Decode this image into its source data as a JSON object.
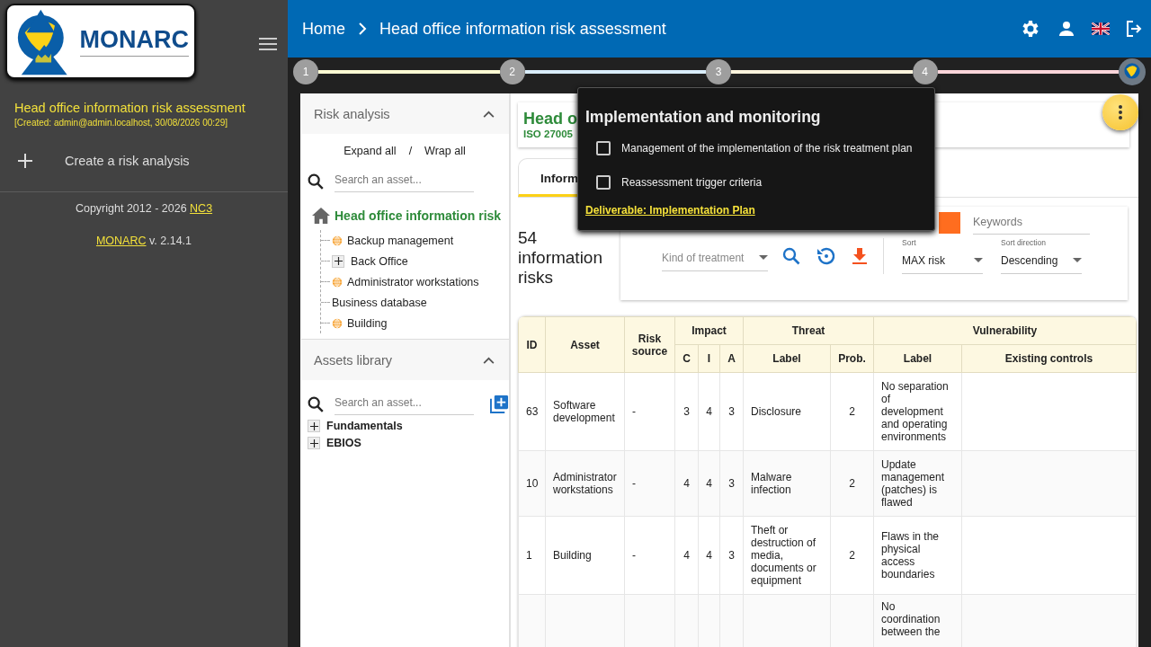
{
  "sidebar": {
    "logo_text": "MONARC",
    "project_title": "Head office information risk assessment",
    "project_created": "[Created: admin@admin.localhost, 30/08/2026 00:29]",
    "create_label": "Create a risk analysis",
    "copyright": "Copyright 2012 - 2026",
    "copyright_link": "NC3",
    "version_link": "MONARC",
    "version": "v. 2.14.1"
  },
  "topbar": {
    "breadcrumb": [
      "Home",
      "Head office information risk assessment"
    ]
  },
  "steps": [
    {
      "kind": "number",
      "label": "1",
      "color": "#fdfbd3"
    },
    {
      "kind": "number",
      "label": "2",
      "color": "#d9edfb"
    },
    {
      "kind": "number",
      "label": "3",
      "color": "#fbf3dc"
    },
    {
      "kind": "number",
      "label": "4",
      "color": "#fbd5da"
    },
    {
      "kind": "logo"
    }
  ],
  "risk_analysis_panel": {
    "title": "Risk analysis",
    "expand_label": "Expand all",
    "separator": "/",
    "wrap_label": "Wrap all",
    "search_placeholder": "Search an asset...",
    "root": "Head office information risk",
    "children": [
      {
        "kind": "globe",
        "label": "Backup management"
      },
      {
        "kind": "expandable",
        "label": "Back Office"
      },
      {
        "kind": "globe",
        "label": "Administrator workstations"
      },
      {
        "kind": "plain",
        "label": "Business database"
      },
      {
        "kind": "globe",
        "label": "Building"
      }
    ]
  },
  "assets_library": {
    "title": "Assets library",
    "search_placeholder": "Search an asset...",
    "items": [
      {
        "label": "Fundamentals"
      },
      {
        "label": "EBIOS"
      }
    ]
  },
  "header_card": {
    "title": "Head o",
    "subtitle": "ISO 27005"
  },
  "tabs": [
    {
      "label": "Inform",
      "selected": true
    }
  ],
  "risk_count": "54 information risks",
  "filters": {
    "keywords_placeholder": "Keywords",
    "treatment_placeholder": "Kind of treatment",
    "sort_label": "Sort",
    "sort_value": "MAX risk",
    "direction_label": "Sort direction",
    "direction_value": "Descending"
  },
  "table": {
    "groups": [
      {
        "label": "ID"
      },
      {
        "label": "Asset"
      },
      {
        "label": "Risk source"
      },
      {
        "label": "Impact",
        "children": [
          "C",
          "I",
          "A"
        ]
      },
      {
        "label": "Threat",
        "children": [
          "Label",
          "Prob."
        ]
      },
      {
        "label": "Vulnerability",
        "children": [
          "Label",
          "Existing controls"
        ]
      }
    ],
    "rows": [
      {
        "id": "63",
        "asset": "Software development",
        "source": "-",
        "c": "3",
        "i": "4",
        "a": "3",
        "threat": "Disclosure",
        "prob": "2",
        "vulnerability": "No separation of development and operating environments"
      },
      {
        "id": "10",
        "asset": "Administrator workstations",
        "source": "-",
        "c": "4",
        "i": "4",
        "a": "3",
        "threat": "Malware infection",
        "prob": "2",
        "vulnerability": "Update management (patches) is flawed"
      },
      {
        "id": "1",
        "asset": "Building",
        "source": "-",
        "c": "4",
        "i": "4",
        "a": "3",
        "threat": "Theft or destruction of media, documents or equipment",
        "prob": "2",
        "vulnerability": "Flaws in the physical access boundaries"
      },
      {
        "vulnerability": "No coordination between the"
      }
    ]
  },
  "popup": {
    "title": "Implementation and monitoring",
    "items": [
      {
        "label": "Management of the implementation of the risk treatment plan",
        "checked": false
      },
      {
        "label": "Reassessment trigger criteria",
        "checked": false
      }
    ],
    "link": "Deliverable: Implementation Plan"
  }
}
